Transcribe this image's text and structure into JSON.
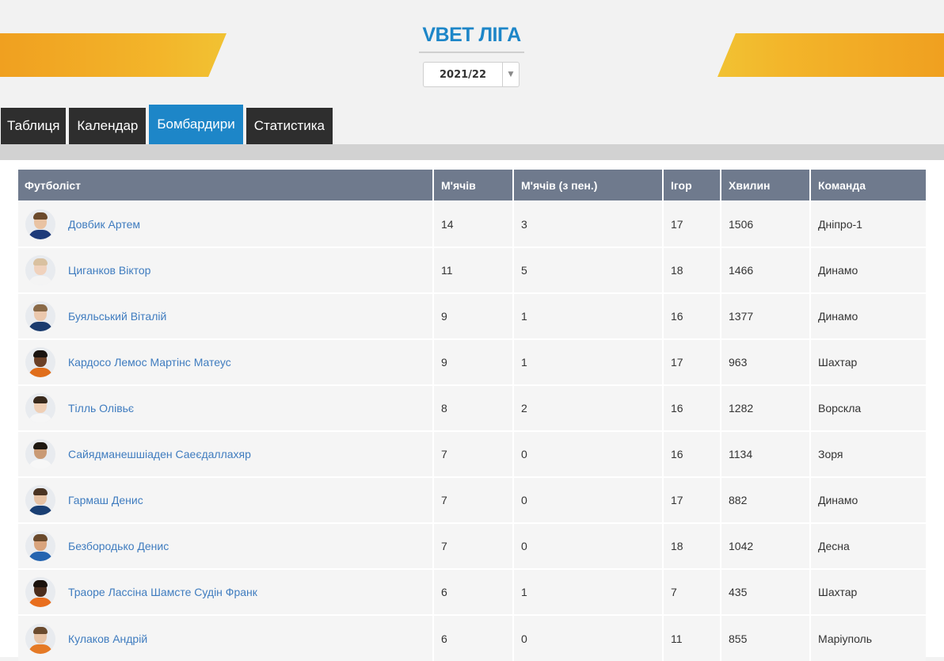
{
  "header": {
    "title": "VBET ЛІГА",
    "season": "2021/22",
    "accent_color": "#1d86c8",
    "band_color": "#f3b52a"
  },
  "tabs": [
    {
      "label": "Таблиця",
      "active": false
    },
    {
      "label": "Календар",
      "active": false
    },
    {
      "label": "Бомбардири",
      "active": true
    },
    {
      "label": "Статистика",
      "active": false
    }
  ],
  "table": {
    "columns": [
      "Футболіст",
      "М'ячів",
      "М'ячів (з пен.)",
      "Ігор",
      "Хвилин",
      "Команда"
    ],
    "rows": [
      {
        "player": "Довбик Артем",
        "goals": "14",
        "pen": "3",
        "games": "17",
        "minutes": "1506",
        "team": "Дніпро-1",
        "skin": "#e9c3a3",
        "hair": "#6b4a2c",
        "shirt": "#1e3b7a"
      },
      {
        "player": "Циганков Віктор",
        "goals": "11",
        "pen": "5",
        "games": "18",
        "minutes": "1466",
        "team": "Динамо",
        "skin": "#f0d2bd",
        "hair": "#d9c1a0",
        "shirt": "#f4f4f4"
      },
      {
        "player": "Буяльський Віталій",
        "goals": "9",
        "pen": "1",
        "games": "16",
        "minutes": "1377",
        "team": "Динамо",
        "skin": "#ebc8ad",
        "hair": "#8a6a48",
        "shirt": "#1a3b6e"
      },
      {
        "player": "Кардосо Лемос Мартінс Матеус",
        "goals": "9",
        "pen": "1",
        "games": "17",
        "minutes": "963",
        "team": "Шахтар",
        "skin": "#6b4027",
        "hair": "#1a1410",
        "shirt": "#e06e1b"
      },
      {
        "player": "Тілль Олівьє",
        "goals": "8",
        "pen": "2",
        "games": "16",
        "minutes": "1282",
        "team": "Ворскла",
        "skin": "#efcfb5",
        "hair": "#3a2a1c",
        "shirt": "#f6f6f6"
      },
      {
        "player": "Сайядманешшіаден Саеєдаллахяр",
        "goals": "7",
        "pen": "0",
        "games": "16",
        "minutes": "1134",
        "team": "Зоря",
        "skin": "#c99a75",
        "hair": "#1e1812",
        "shirt": "#f7f7f7"
      },
      {
        "player": "Гармаш Денис",
        "goals": "7",
        "pen": "0",
        "games": "17",
        "minutes": "882",
        "team": "Динамо",
        "skin": "#e6c2a4",
        "hair": "#4a3422",
        "shirt": "#1a3f73"
      },
      {
        "player": "Безбородько Денис",
        "goals": "7",
        "pen": "0",
        "games": "18",
        "minutes": "1042",
        "team": "Десна",
        "skin": "#d9a47d",
        "hair": "#6a4a2c",
        "shirt": "#2464b0"
      },
      {
        "player": "Траоре Лассіна Шамсте Судін Франк",
        "goals": "6",
        "pen": "1",
        "games": "7",
        "minutes": "435",
        "team": "Шахтар",
        "skin": "#4a2c1c",
        "hair": "#1a120c",
        "shirt": "#e86e1e"
      },
      {
        "player": "Кулаков Андрій",
        "goals": "6",
        "pen": "0",
        "games": "11",
        "minutes": "855",
        "team": "Маріуполь",
        "skin": "#e8c4a6",
        "hair": "#6b4b2e",
        "shirt": "#e57a26"
      }
    ]
  }
}
